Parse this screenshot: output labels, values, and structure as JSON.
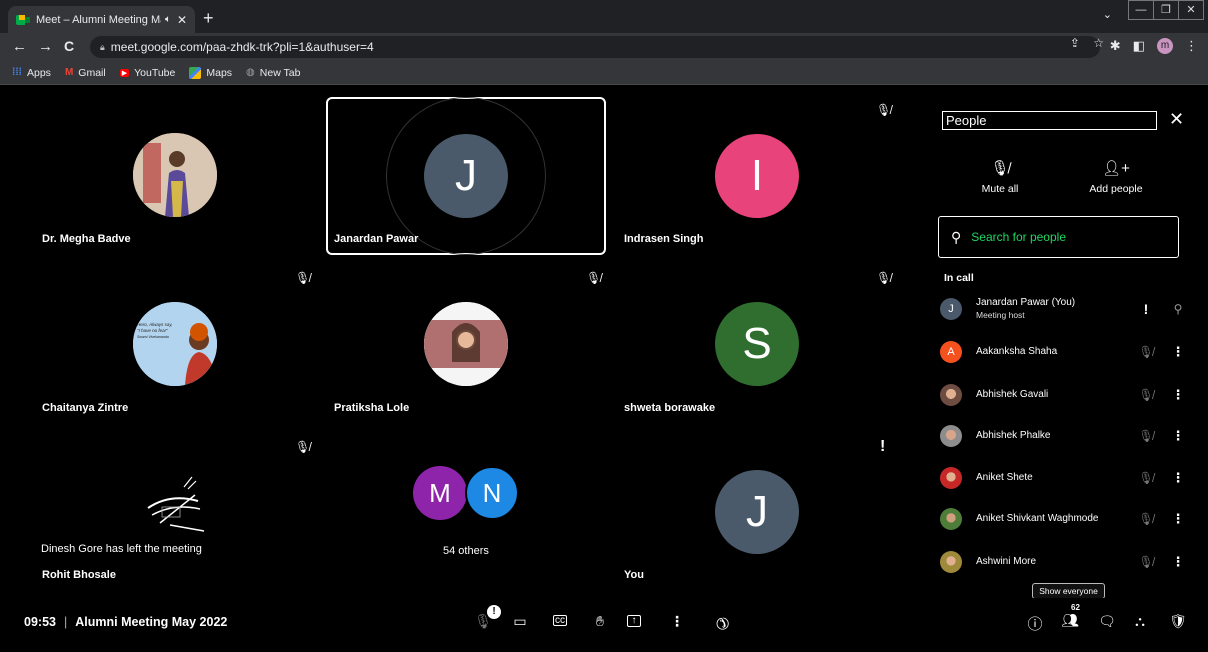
{
  "browser": {
    "tab_title": "Meet – Alumni Meeting May",
    "tab_audio_icon": "speaker-icon",
    "url": "meet.google.com/paa-zhdk-trk?pli=1&authuser=4",
    "profile_initial": "m",
    "bookmarks": [
      {
        "label": "Apps",
        "icon": "apps-grid-icon"
      },
      {
        "label": "Gmail",
        "icon": "gmail-icon"
      },
      {
        "label": "YouTube",
        "icon": "youtube-icon"
      },
      {
        "label": "Maps",
        "icon": "maps-icon"
      },
      {
        "label": "New Tab",
        "icon": "globe-icon"
      }
    ]
  },
  "tiles": [
    {
      "name": "Dr. Megha Badve",
      "avatar_type": "photo"
    },
    {
      "name": "Janardan Pawar",
      "initial": "J",
      "color": "#4a5a6a",
      "active_speaker": true
    },
    {
      "name": "Indrasen Singh",
      "initial": "I",
      "color": "#e8437a"
    },
    {
      "name": "Chaitanya Zintre",
      "avatar_type": "photo",
      "photo_text": [
        "Hero, Always say,",
        "\"I have no fear\"",
        "Swami Vivekananda"
      ]
    },
    {
      "name": "Pratiksha Lole",
      "avatar_type": "photo"
    },
    {
      "name": "shweta borawake",
      "initial": "S",
      "color": "#2f6e2f"
    },
    {
      "name": "Rohit Bhosale",
      "avatar_type": "photo"
    },
    {
      "name": "You",
      "initial": "J",
      "color": "#4a5a6a"
    }
  ],
  "others": {
    "label": "54 others",
    "initials": [
      "M",
      "N"
    ],
    "colors": [
      "#8e24aa",
      "#1e88e5"
    ]
  },
  "left_message": "Dinesh Gore has left the meeting",
  "panel": {
    "title": "People",
    "mute_all": "Mute all",
    "add_people": "Add people",
    "search_placeholder": "Search for people",
    "in_call": "In call",
    "show_everyone": "Show everyone",
    "people": [
      {
        "name": "Janardan Pawar (You)",
        "sub": "Meeting host",
        "initial": "J",
        "color": "#4a5a6a"
      },
      {
        "name": "Aakanksha Shaha",
        "initial": "A",
        "color": "#f4511e"
      },
      {
        "name": "Abhishek Gavali",
        "initial": "",
        "color": "#6d4c41"
      },
      {
        "name": "Abhishek Phalke",
        "initial": "",
        "color": "#8d8d8d"
      },
      {
        "name": "Aniket Shete",
        "initial": "",
        "color": "#c62828"
      },
      {
        "name": "Aniket Shivkant Waghmode",
        "initial": "",
        "color": "#4e7d3a"
      },
      {
        "name": "Ashwini More",
        "initial": "",
        "color": "#9e8a3a"
      }
    ]
  },
  "footer": {
    "time": "09:53",
    "separator": "|",
    "meeting_name": "Alumni Meeting May 2022",
    "people_count": "62"
  }
}
